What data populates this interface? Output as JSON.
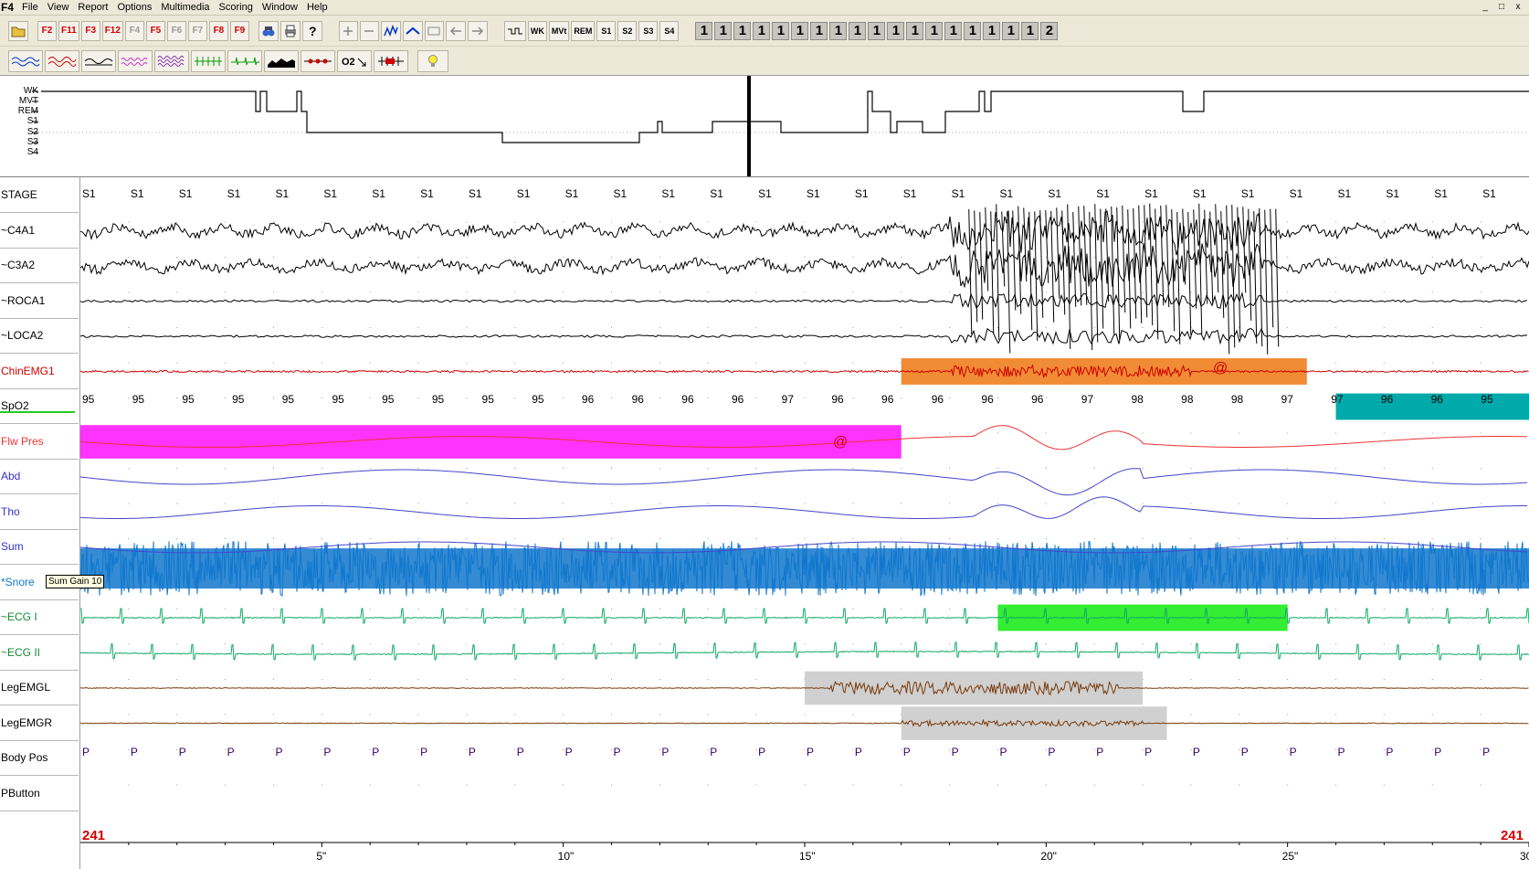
{
  "app": {
    "logo": "F4"
  },
  "menu": [
    "File",
    "View",
    "Report",
    "Options",
    "Multimedia",
    "Scoring",
    "Window",
    "Help"
  ],
  "window_controls": [
    "_",
    "□",
    "x"
  ],
  "toolbar1": {
    "fkeys": [
      {
        "label": "F2",
        "state": "active"
      },
      {
        "label": "F11",
        "state": "active"
      },
      {
        "label": "F3",
        "state": "active"
      },
      {
        "label": "F12",
        "state": "active"
      },
      {
        "label": "F4",
        "state": "disabled"
      },
      {
        "label": "F5",
        "state": "active"
      },
      {
        "label": "F6",
        "state": "disabled"
      },
      {
        "label": "F7",
        "state": "disabled"
      },
      {
        "label": "F8",
        "state": "active"
      },
      {
        "label": "F9",
        "state": "active"
      }
    ],
    "stage_buttons": [
      "WK",
      "MVt",
      "REM",
      "S1",
      "S2",
      "S3",
      "S4"
    ],
    "counters": [
      "1",
      "1",
      "1",
      "1",
      "1",
      "1",
      "1",
      "1",
      "1",
      "1",
      "1",
      "1",
      "1",
      "1",
      "1",
      "1",
      "1",
      "1",
      "2"
    ]
  },
  "hypnogram": {
    "levels": [
      "WK",
      "MVT",
      "REM",
      "S1",
      "S2",
      "S3",
      "S4"
    ]
  },
  "channels": [
    {
      "name": "STAGE",
      "color": "#000000"
    },
    {
      "name": "~C4A1",
      "color": "#000000"
    },
    {
      "name": "~C3A2",
      "color": "#000000"
    },
    {
      "name": "~ROCA1",
      "color": "#000000"
    },
    {
      "name": "~LOCA2",
      "color": "#000000"
    },
    {
      "name": "ChinEMG1",
      "color": "#cc0000"
    },
    {
      "name": "SpO2",
      "color": "#000000"
    },
    {
      "name": "Flw Pres",
      "color": "#ee3333"
    },
    {
      "name": "Abd",
      "color": "#3333cc"
    },
    {
      "name": "Tho",
      "color": "#3333cc"
    },
    {
      "name": "Sum",
      "color": "#3333cc"
    },
    {
      "name": "*Snore",
      "color": "#1177cc"
    },
    {
      "name": "~ECG I",
      "color": "#118833"
    },
    {
      "name": "~ECG II",
      "color": "#118833"
    },
    {
      "name": "LegEMGL",
      "color": "#000000"
    },
    {
      "name": "LegEMGR",
      "color": "#000000"
    },
    {
      "name": "Body Pos",
      "color": "#000000"
    },
    {
      "name": "PButton",
      "color": "#000000"
    }
  ],
  "stage_labels": [
    "S1",
    "S1",
    "S1",
    "S1",
    "S1",
    "S1",
    "S1",
    "S1",
    "S1",
    "S1",
    "S1",
    "S1",
    "S1",
    "S1",
    "S1",
    "S1",
    "S1",
    "S1",
    "S1",
    "S1",
    "S1",
    "S1",
    "S1",
    "S1",
    "S1",
    "S1",
    "S1",
    "S1",
    "S1",
    "S1"
  ],
  "spo2_values": [
    "95",
    "95",
    "95",
    "95",
    "95",
    "95",
    "95",
    "95",
    "95",
    "95",
    "96",
    "96",
    "96",
    "96",
    "97",
    "96",
    "96",
    "96",
    "96",
    "96",
    "97",
    "98",
    "98",
    "98",
    "97",
    "97",
    "96",
    "96",
    "95"
  ],
  "body_pos": [
    "P",
    "P",
    "P",
    "P",
    "P",
    "P",
    "P",
    "P",
    "P",
    "P",
    "P",
    "P",
    "P",
    "P",
    "P",
    "P",
    "P",
    "P",
    "P",
    "P",
    "P",
    "P",
    "P",
    "P",
    "P",
    "P",
    "P",
    "P",
    "P",
    "P"
  ],
  "event_marker": "@",
  "tooltip": "Sum Gain 10",
  "epoch": {
    "left": "241",
    "right": "241"
  },
  "time_ticks": [
    "5\"",
    "10\"",
    "15\"",
    "20\"",
    "25\"",
    "30"
  ],
  "colors": {
    "eeg": "#000000",
    "emg": "#cc0000",
    "flow": "#ee3333",
    "effort": "#4444cc",
    "snore": "#1177cc",
    "ecg": "#11aa66",
    "leg": "#7a3a0a",
    "arousal": "#f08020",
    "apnea": "#ff33ff",
    "desat": "#00aaaa",
    "ecg_event": "#33ee33",
    "limb": "#c8c8c8",
    "hypno": "#000000"
  }
}
